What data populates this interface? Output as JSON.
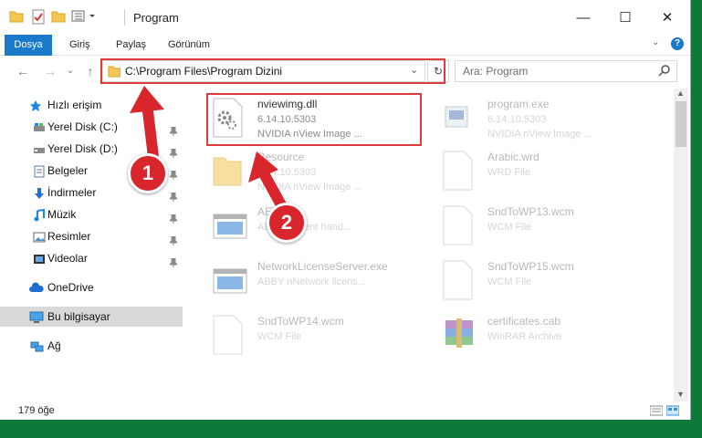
{
  "window": {
    "title": "Program",
    "minimize_glyph": "—",
    "maximize_glyph": "☐",
    "close_glyph": "✕"
  },
  "ribbon": {
    "tabs": [
      "Dosya",
      "Giriş",
      "Paylaş",
      "Görünüm"
    ]
  },
  "address": {
    "path": "C:\\Program Files\\Program Dizini"
  },
  "search": {
    "placeholder": "Ara: Program"
  },
  "nav": {
    "quick_access": "Hızlı erişim",
    "items": [
      "Yerel Disk (C:)",
      "Yerel Disk (D:)",
      "Belgeler",
      "İndirmeler",
      "Müzik",
      "Resimler",
      "Videolar"
    ],
    "onedrive": "OneDrive",
    "this_pc": "Bu bilgisayar",
    "network": "Ağ"
  },
  "files": [
    {
      "name": "nviewimg.dll",
      "line1": "6.14.10.5303",
      "line2": "NVIDIA nView Image ...",
      "icon": "gear-dll-icon"
    },
    {
      "name": "program.exe",
      "line1": "6.14.10.5303",
      "line2": "NVIDIA nView Image ...",
      "icon": "exe-icon"
    },
    {
      "name": "Resource",
      "line1": "6.14.10.5303",
      "line2": "NVIDIA nView Image ...",
      "icon": "folder-icon"
    },
    {
      "name": "Arabic.wrd",
      "line1": "WRD File",
      "line2": "",
      "icon": "blank-file-icon"
    },
    {
      "name": "AEW.exe",
      "line1": "ABBYY event hand...",
      "line2": "",
      "icon": "window-app-icon"
    },
    {
      "name": "SndToWP13.wcm",
      "line1": "WCM File",
      "line2": "",
      "icon": "blank-file-icon"
    },
    {
      "name": "NetworkLicenseServer.exe",
      "line1": "ABBY nNetwork licens...",
      "line2": "",
      "icon": "window-app-icon"
    },
    {
      "name": "SndToWP15.wcm",
      "line1": "WCM File",
      "line2": "",
      "icon": "blank-file-icon"
    },
    {
      "name": "SndToWP14.wcm",
      "line1": "WCM File",
      "line2": "",
      "icon": "blank-file-icon"
    },
    {
      "name": "certificates.cab",
      "line1": "WinRAR Archive",
      "line2": "",
      "icon": "winrar-icon"
    }
  ],
  "status": {
    "count": "179 öğe"
  },
  "annotations": {
    "step1": "1",
    "step2": "2",
    "highlight_color": "#e03b3b",
    "badge_color": "#d8262c"
  },
  "colors": {
    "accent": "#1979ca",
    "selection": "#cce8ff"
  }
}
